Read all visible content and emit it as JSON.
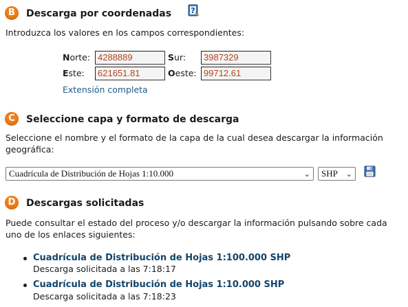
{
  "section_b": {
    "badge": "B",
    "title": "Descarga por coordenadas",
    "help_icon": "help-book-icon",
    "intro": "Introduzca los valores en los campos correspondientes:",
    "fields": {
      "norte": {
        "label_first": "N",
        "label_rest": "orte:",
        "value": "4288889"
      },
      "sur": {
        "label_first": "S",
        "label_rest": "ur:",
        "value": "3987329"
      },
      "este": {
        "label_first": "E",
        "label_rest": "ste:",
        "value": "621651.81"
      },
      "oeste": {
        "label_first": "O",
        "label_rest": "este:",
        "value": "99712.61"
      }
    },
    "extent_link": "Extensión completa"
  },
  "section_c": {
    "badge": "C",
    "title": "Seleccione capa y formato de descarga",
    "intro_line1": "Seleccione el nombre y el formato de la capa de la cual desea descargar la información",
    "intro_line2": "geográfica:",
    "layer_select": "Cuadrícula de Distribución de Hojas 1:10.000",
    "format_select": "SHP",
    "save_icon": "floppy-disk-icon"
  },
  "section_d": {
    "badge": "D",
    "title": "Descargas solicitadas",
    "intro_line1": "Puede consultar el estado del proceso y/o descargar la información pulsando sobre cada",
    "intro_line2": "uno de los enlaces siguientes:",
    "requests": [
      {
        "title": "Cuadrícula de Distribución de Hojas 1:100.000 SHP",
        "status": "Descarga solicitada a las 7:18:17"
      },
      {
        "title": "Cuadrícula de Distribución de Hojas 1:10.000 SHP",
        "status": "Descarga solicitada a las 7:18:23"
      }
    ]
  },
  "colors": {
    "badge": "#f07f19",
    "link": "#1b5c82",
    "input_text": "#b5451b"
  }
}
